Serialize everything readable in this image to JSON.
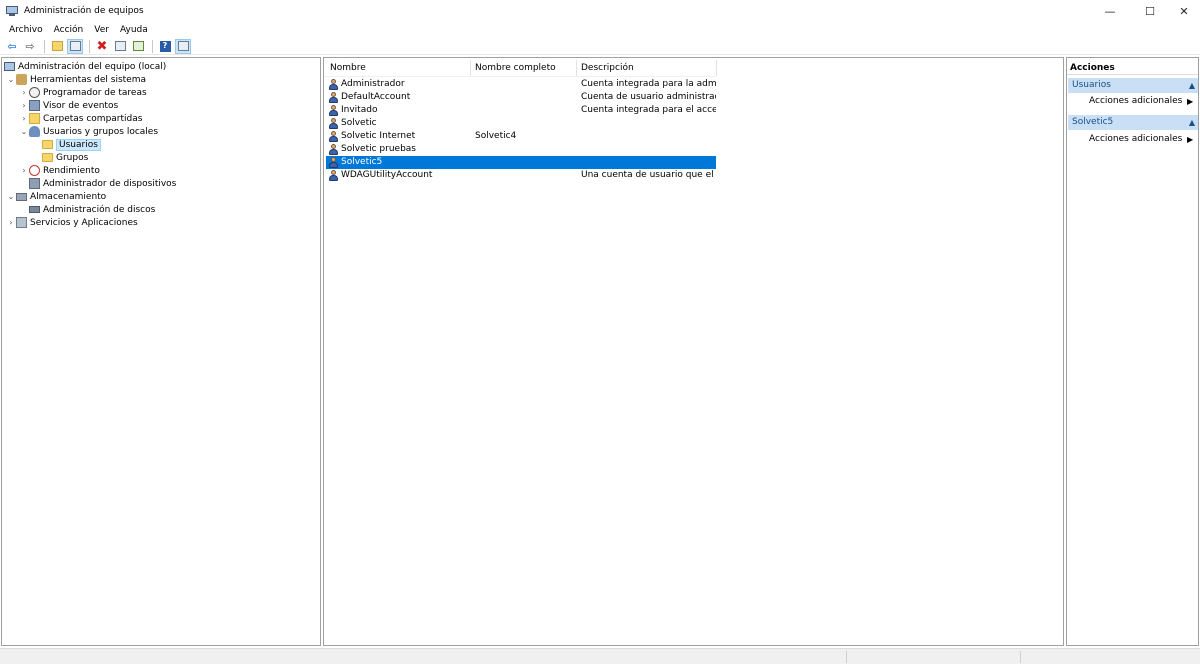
{
  "window": {
    "title": "Administración de equipos",
    "controls": {
      "minimize": "—",
      "maximize": "☐",
      "close": "✕"
    }
  },
  "menu": [
    "Archivo",
    "Acción",
    "Ver",
    "Ayuda"
  ],
  "toolbar_icons": [
    "back-arrow-icon",
    "forward-arrow-icon",
    "up-folder-icon",
    "show-hide-tree-icon",
    "delete-icon",
    "properties-icon",
    "export-list-icon",
    "help-icon",
    "show-hide-action-pane-icon"
  ],
  "tree": {
    "root": "Administración del equipo (local)",
    "items": [
      {
        "label": "Herramientas del sistema",
        "twisty": "⌄"
      },
      {
        "label": "Programador de tareas",
        "twisty": "›"
      },
      {
        "label": "Visor de eventos",
        "twisty": "›"
      },
      {
        "label": "Carpetas compartidas",
        "twisty": "›"
      },
      {
        "label": "Usuarios y grupos locales",
        "twisty": "⌄"
      },
      {
        "label": "Usuarios",
        "twisty": ""
      },
      {
        "label": "Grupos",
        "twisty": ""
      },
      {
        "label": "Rendimiento",
        "twisty": "›"
      },
      {
        "label": "Administrador de dispositivos",
        "twisty": ""
      },
      {
        "label": "Almacenamiento",
        "twisty": "⌄"
      },
      {
        "label": "Administración de discos",
        "twisty": ""
      },
      {
        "label": "Servicios y Aplicaciones",
        "twisty": "›"
      }
    ]
  },
  "list": {
    "columns": [
      "Nombre",
      "Nombre completo",
      "Descripción"
    ],
    "rows": [
      {
        "name": "Administrador",
        "full_name": "",
        "description": "Cuenta integrada para la administ..."
      },
      {
        "name": "DefaultAccount",
        "full_name": "",
        "description": "Cuenta de usuario administrada p..."
      },
      {
        "name": "Invitado",
        "full_name": "",
        "description": "Cuenta integrada para el acceso c..."
      },
      {
        "name": "Solvetic",
        "full_name": "",
        "description": ""
      },
      {
        "name": "Solvetic Internet",
        "full_name": "Solvetic4",
        "description": ""
      },
      {
        "name": "Solvetic pruebas",
        "full_name": "",
        "description": ""
      },
      {
        "name": "Solvetic5",
        "full_name": "",
        "description": ""
      },
      {
        "name": "WDAGUtilityAccount",
        "full_name": "",
        "description": "Una cuenta de usuario que el siste..."
      }
    ],
    "selected_row": "Solvetic5"
  },
  "actions": {
    "title": "Acciones",
    "sections": [
      {
        "header": "Usuarios",
        "item": "Acciones adicionales"
      },
      {
        "header": "Solvetic5",
        "item": "Acciones adicionales"
      }
    ],
    "caret": "▲",
    "item_arrow": "▶"
  },
  "colors": {
    "selection": "#0078d7",
    "section_header": "#c8dff5",
    "tree_selection": "#cce8ff"
  }
}
